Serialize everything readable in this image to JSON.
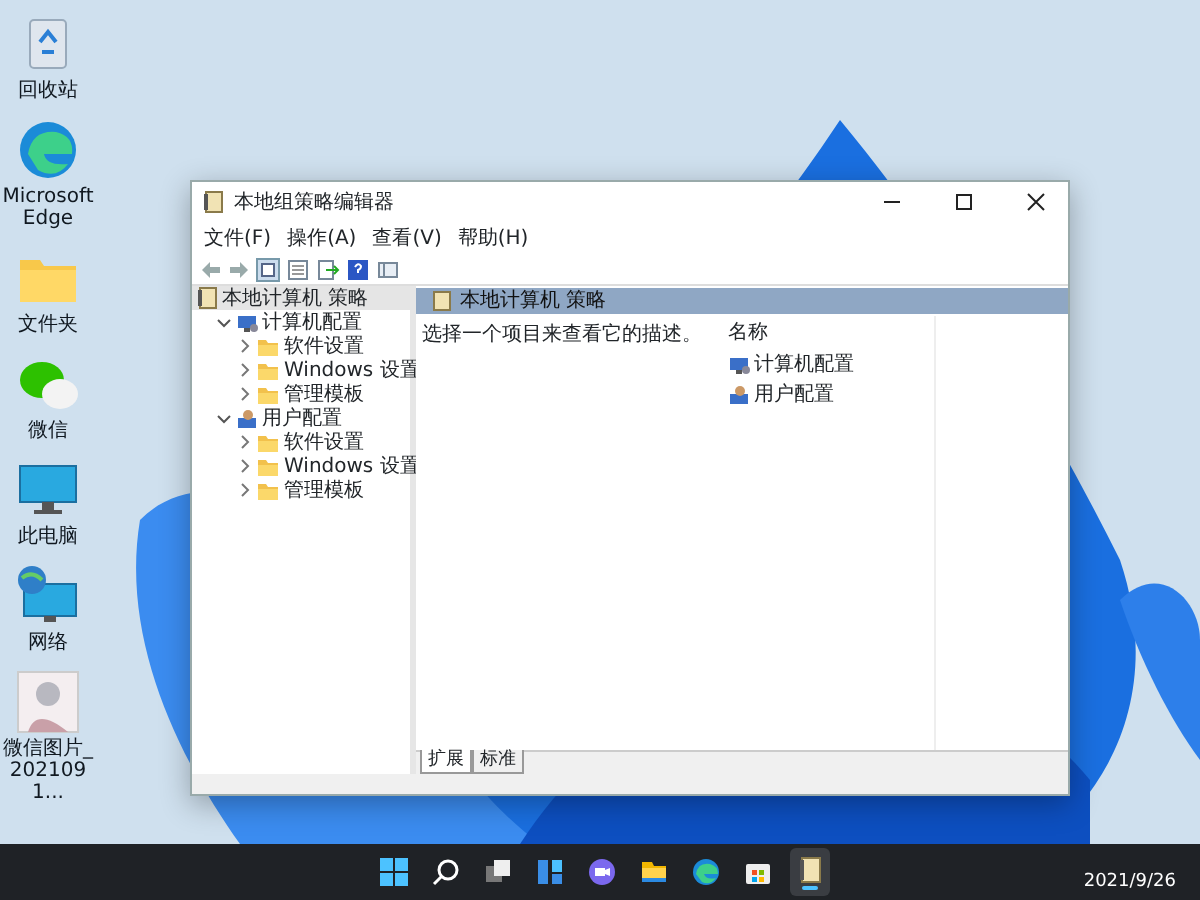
{
  "desktop_icons": [
    {
      "label": "回收站",
      "kind": "recycle"
    },
    {
      "label": "Microsoft Edge",
      "kind": "edge"
    },
    {
      "label": "文件夹",
      "kind": "folder"
    },
    {
      "label": "微信",
      "kind": "wechat"
    },
    {
      "label": "此电脑",
      "kind": "pc"
    },
    {
      "label": "网络",
      "kind": "network"
    },
    {
      "label": "微信图片_2021091...",
      "kind": "image"
    }
  ],
  "window": {
    "title": "本地组策略编辑器",
    "menu": [
      "文件(F)",
      "操作(A)",
      "查看(V)",
      "帮助(H)"
    ],
    "tree": [
      {
        "label": "本地计算机 策略",
        "kind": "policy",
        "selected": true,
        "children": [
          {
            "label": "计算机配置",
            "kind": "computer",
            "selected": false,
            "expanded": true,
            "children": [
              {
                "label": "软件设置",
                "kind": "folder",
                "selected": false,
                "expanded": false
              },
              {
                "label": "Windows 设置",
                "kind": "folder",
                "selected": false,
                "expanded": false
              },
              {
                "label": "管理模板",
                "kind": "folder",
                "selected": false,
                "expanded": false
              }
            ]
          },
          {
            "label": "用户配置",
            "kind": "user",
            "selected": false,
            "expanded": true,
            "children": [
              {
                "label": "软件设置",
                "kind": "folder",
                "selected": false,
                "expanded": false
              },
              {
                "label": "Windows 设置",
                "kind": "folder",
                "selected": false,
                "expanded": false
              },
              {
                "label": "管理模板",
                "kind": "folder",
                "selected": false,
                "expanded": false
              }
            ]
          }
        ]
      }
    ],
    "content": {
      "header": "本地计算机 策略",
      "description": "选择一个项目来查看它的描述。",
      "column": "名称",
      "items": [
        {
          "label": "计算机配置",
          "kind": "computer"
        },
        {
          "label": "用户配置",
          "kind": "user"
        }
      ]
    },
    "tabs": [
      {
        "label": "扩展",
        "selected": true
      },
      {
        "label": "标准",
        "selected": false
      }
    ]
  },
  "taskbar": {
    "apps": [
      {
        "kind": "start",
        "running": false
      },
      {
        "kind": "search",
        "running": false
      },
      {
        "kind": "taskview",
        "running": false
      },
      {
        "kind": "widgets",
        "running": false
      },
      {
        "kind": "chat",
        "running": false
      },
      {
        "kind": "explorer",
        "running": false
      },
      {
        "kind": "edge",
        "running": false
      },
      {
        "kind": "store",
        "running": false
      },
      {
        "kind": "policy",
        "running": true
      }
    ],
    "date": "2021/9/26"
  }
}
